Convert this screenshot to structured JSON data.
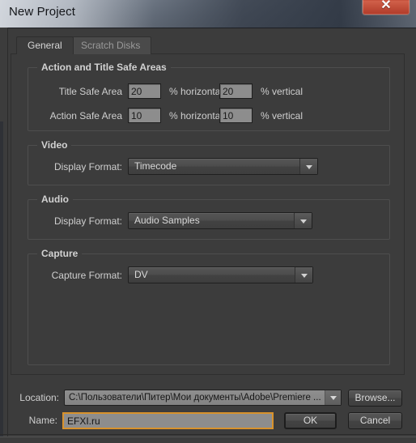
{
  "window": {
    "title": "New Project",
    "close_label": "✕",
    "close_icon": "close-icon",
    "accent_focus_color": "#d8922c",
    "close_button_color": "#c14a36",
    "panel_bg": "#3c3c3c"
  },
  "tabs": [
    {
      "label": "General",
      "active": true
    },
    {
      "label": "Scratch Disks",
      "active": false
    }
  ],
  "groups": {
    "safe_areas": {
      "title": "Action and Title Safe Areas",
      "rows": [
        {
          "label": "Title Safe Area",
          "horizontal_value": "20",
          "horizontal_unit": "% horizontal",
          "vertical_value": "20",
          "vertical_unit": "% vertical"
        },
        {
          "label": "Action Safe Area",
          "horizontal_value": "10",
          "horizontal_unit": "% horizontal",
          "vertical_value": "10",
          "vertical_unit": "% vertical"
        }
      ]
    },
    "video": {
      "title": "Video",
      "field_label": "Display Format:",
      "value": "Timecode"
    },
    "audio": {
      "title": "Audio",
      "field_label": "Display Format:",
      "value": "Audio Samples"
    },
    "capture": {
      "title": "Capture",
      "field_label": "Capture Format:",
      "value": "DV"
    }
  },
  "footer": {
    "location_label": "Location:",
    "location_value": "C:\\Пользователи\\Питер\\Мои документы\\Adobe\\Premiere ...",
    "browse_label": "Browse...",
    "name_label": "Name:",
    "name_value": "EFXI.ru",
    "ok_label": "OK",
    "cancel_label": "Cancel"
  }
}
